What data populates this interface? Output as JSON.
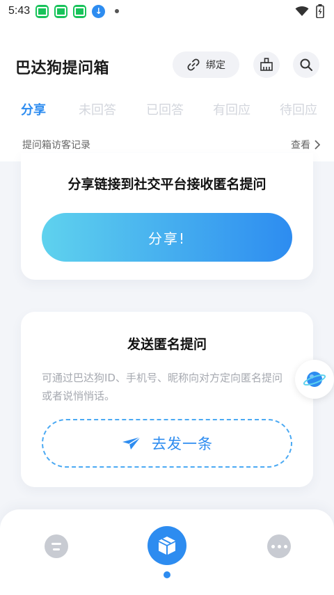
{
  "status": {
    "time": "5:43",
    "notification_icons": [
      "app-notification-icon",
      "app-notification-icon",
      "app-notification-icon",
      "download-icon"
    ]
  },
  "header": {
    "title": "巴达狗提问箱",
    "bind_label": "绑定"
  },
  "tabs": [
    {
      "label": "分享",
      "active": true
    },
    {
      "label": "未回答",
      "active": false
    },
    {
      "label": "已回答",
      "active": false
    },
    {
      "label": "有回应",
      "active": false
    },
    {
      "label": "待回应",
      "active": false
    }
  ],
  "visitor": {
    "label": "提问箱访客记录",
    "link": "查看"
  },
  "share_card": {
    "title": "分享链接到社交平台接收匿名提问",
    "button": "分享!"
  },
  "send_card": {
    "title": "发送匿名提问",
    "description": "可通过巴达狗ID、手机号、昵称向对方定向匿名提问或者说悄悄话。",
    "button": "去发一条"
  },
  "colors": {
    "accent": "#2d8cf0",
    "gradient_start": "#5fd2ee",
    "inactive_tab": "#d3d6dd"
  },
  "bottom_nav": {
    "active_index": 1
  }
}
